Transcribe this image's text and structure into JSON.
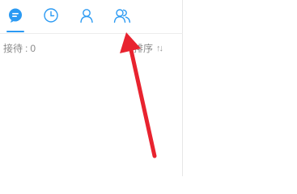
{
  "tabs": [
    {
      "icon": "chat-bubble-icon",
      "active": true
    },
    {
      "icon": "clock-icon",
      "active": false
    },
    {
      "icon": "user-icon",
      "active": false
    },
    {
      "icon": "users-icon",
      "active": false
    }
  ],
  "status": {
    "reception_label": "接待",
    "separator": ":",
    "reception_count": "0",
    "sort_label": "排序",
    "sort_icon": "sort-arrows-icon"
  },
  "annotation": {
    "arrow_color": "#e8232f",
    "points_to": "users-icon"
  },
  "colors": {
    "accent": "#2b9af3",
    "muted_text": "#8a8a8a",
    "divider": "#e6e6e6"
  }
}
